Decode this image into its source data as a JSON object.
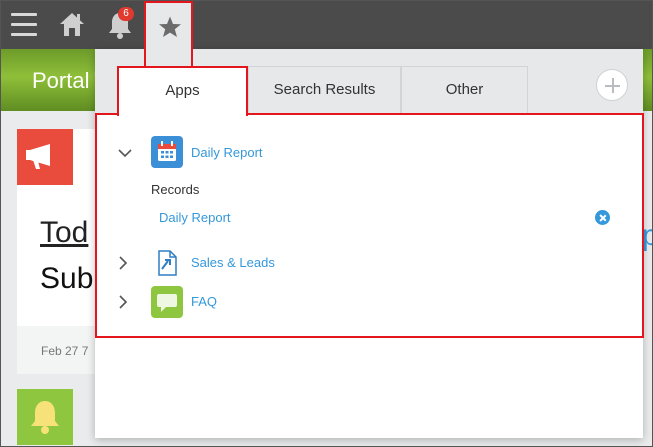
{
  "topbar": {
    "notification_count": "6"
  },
  "background": {
    "portal_title": "Portal",
    "card_title_partial": "Tod",
    "card_sub_partial": "Sub",
    "card_date_partial": "Feb 27 7",
    "right_partial": "p"
  },
  "panel": {
    "tabs": [
      {
        "label": "Apps",
        "active": true
      },
      {
        "label": "Search Results",
        "active": false
      },
      {
        "label": "Other",
        "active": false
      }
    ],
    "apps": [
      {
        "name": "Daily Report",
        "icon": "calendar-icon",
        "expanded": true,
        "color": "#3b8fd6"
      },
      {
        "name": "Sales & Leads",
        "icon": "document-icon",
        "expanded": false,
        "color": "#ffffff"
      },
      {
        "name": "FAQ",
        "icon": "chat-bubble-icon",
        "expanded": false,
        "color": "#8ec640"
      }
    ],
    "records_label": "Records",
    "record_item": "Daily Report"
  },
  "colors": {
    "accent": "#3498db",
    "highlight_border": "#e3161e",
    "topbar": "#4b4b4b"
  }
}
